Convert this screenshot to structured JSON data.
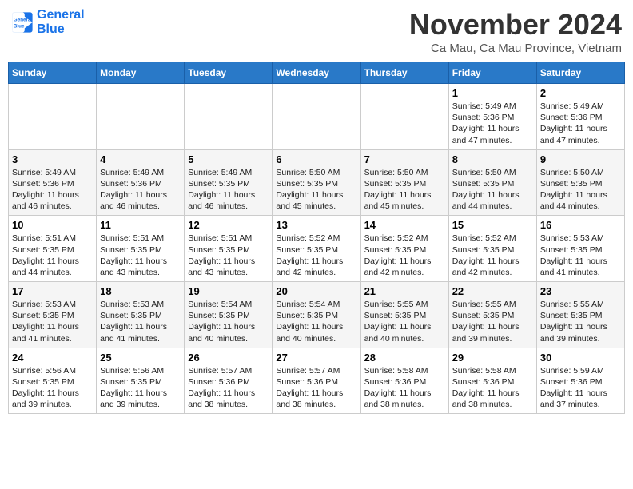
{
  "logo": {
    "line1": "General",
    "line2": "Blue"
  },
  "header": {
    "month": "November 2024",
    "location": "Ca Mau, Ca Mau Province, Vietnam"
  },
  "weekdays": [
    "Sunday",
    "Monday",
    "Tuesday",
    "Wednesday",
    "Thursday",
    "Friday",
    "Saturday"
  ],
  "weeks": [
    [
      {
        "day": "",
        "info": ""
      },
      {
        "day": "",
        "info": ""
      },
      {
        "day": "",
        "info": ""
      },
      {
        "day": "",
        "info": ""
      },
      {
        "day": "",
        "info": ""
      },
      {
        "day": "1",
        "info": "Sunrise: 5:49 AM\nSunset: 5:36 PM\nDaylight: 11 hours\nand 47 minutes."
      },
      {
        "day": "2",
        "info": "Sunrise: 5:49 AM\nSunset: 5:36 PM\nDaylight: 11 hours\nand 47 minutes."
      }
    ],
    [
      {
        "day": "3",
        "info": "Sunrise: 5:49 AM\nSunset: 5:36 PM\nDaylight: 11 hours\nand 46 minutes."
      },
      {
        "day": "4",
        "info": "Sunrise: 5:49 AM\nSunset: 5:36 PM\nDaylight: 11 hours\nand 46 minutes."
      },
      {
        "day": "5",
        "info": "Sunrise: 5:49 AM\nSunset: 5:35 PM\nDaylight: 11 hours\nand 46 minutes."
      },
      {
        "day": "6",
        "info": "Sunrise: 5:50 AM\nSunset: 5:35 PM\nDaylight: 11 hours\nand 45 minutes."
      },
      {
        "day": "7",
        "info": "Sunrise: 5:50 AM\nSunset: 5:35 PM\nDaylight: 11 hours\nand 45 minutes."
      },
      {
        "day": "8",
        "info": "Sunrise: 5:50 AM\nSunset: 5:35 PM\nDaylight: 11 hours\nand 44 minutes."
      },
      {
        "day": "9",
        "info": "Sunrise: 5:50 AM\nSunset: 5:35 PM\nDaylight: 11 hours\nand 44 minutes."
      }
    ],
    [
      {
        "day": "10",
        "info": "Sunrise: 5:51 AM\nSunset: 5:35 PM\nDaylight: 11 hours\nand 44 minutes."
      },
      {
        "day": "11",
        "info": "Sunrise: 5:51 AM\nSunset: 5:35 PM\nDaylight: 11 hours\nand 43 minutes."
      },
      {
        "day": "12",
        "info": "Sunrise: 5:51 AM\nSunset: 5:35 PM\nDaylight: 11 hours\nand 43 minutes."
      },
      {
        "day": "13",
        "info": "Sunrise: 5:52 AM\nSunset: 5:35 PM\nDaylight: 11 hours\nand 42 minutes."
      },
      {
        "day": "14",
        "info": "Sunrise: 5:52 AM\nSunset: 5:35 PM\nDaylight: 11 hours\nand 42 minutes."
      },
      {
        "day": "15",
        "info": "Sunrise: 5:52 AM\nSunset: 5:35 PM\nDaylight: 11 hours\nand 42 minutes."
      },
      {
        "day": "16",
        "info": "Sunrise: 5:53 AM\nSunset: 5:35 PM\nDaylight: 11 hours\nand 41 minutes."
      }
    ],
    [
      {
        "day": "17",
        "info": "Sunrise: 5:53 AM\nSunset: 5:35 PM\nDaylight: 11 hours\nand 41 minutes."
      },
      {
        "day": "18",
        "info": "Sunrise: 5:53 AM\nSunset: 5:35 PM\nDaylight: 11 hours\nand 41 minutes."
      },
      {
        "day": "19",
        "info": "Sunrise: 5:54 AM\nSunset: 5:35 PM\nDaylight: 11 hours\nand 40 minutes."
      },
      {
        "day": "20",
        "info": "Sunrise: 5:54 AM\nSunset: 5:35 PM\nDaylight: 11 hours\nand 40 minutes."
      },
      {
        "day": "21",
        "info": "Sunrise: 5:55 AM\nSunset: 5:35 PM\nDaylight: 11 hours\nand 40 minutes."
      },
      {
        "day": "22",
        "info": "Sunrise: 5:55 AM\nSunset: 5:35 PM\nDaylight: 11 hours\nand 39 minutes."
      },
      {
        "day": "23",
        "info": "Sunrise: 5:55 AM\nSunset: 5:35 PM\nDaylight: 11 hours\nand 39 minutes."
      }
    ],
    [
      {
        "day": "24",
        "info": "Sunrise: 5:56 AM\nSunset: 5:35 PM\nDaylight: 11 hours\nand 39 minutes."
      },
      {
        "day": "25",
        "info": "Sunrise: 5:56 AM\nSunset: 5:35 PM\nDaylight: 11 hours\nand 39 minutes."
      },
      {
        "day": "26",
        "info": "Sunrise: 5:57 AM\nSunset: 5:36 PM\nDaylight: 11 hours\nand 38 minutes."
      },
      {
        "day": "27",
        "info": "Sunrise: 5:57 AM\nSunset: 5:36 PM\nDaylight: 11 hours\nand 38 minutes."
      },
      {
        "day": "28",
        "info": "Sunrise: 5:58 AM\nSunset: 5:36 PM\nDaylight: 11 hours\nand 38 minutes."
      },
      {
        "day": "29",
        "info": "Sunrise: 5:58 AM\nSunset: 5:36 PM\nDaylight: 11 hours\nand 38 minutes."
      },
      {
        "day": "30",
        "info": "Sunrise: 5:59 AM\nSunset: 5:36 PM\nDaylight: 11 hours\nand 37 minutes."
      }
    ]
  ]
}
